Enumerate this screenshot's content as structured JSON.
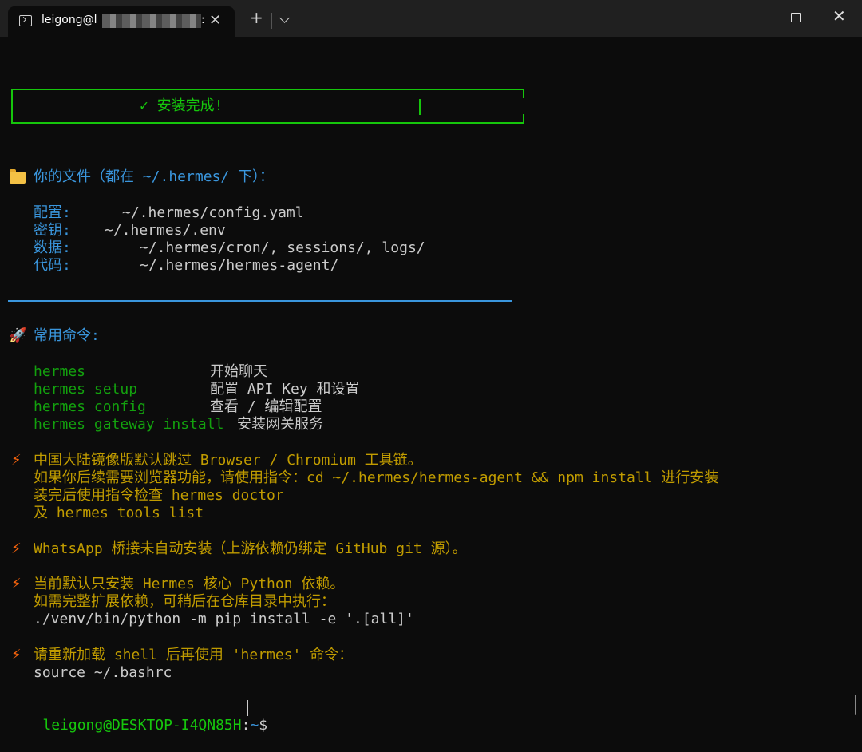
{
  "window": {
    "tab_title": "leigong@l",
    "tab_title_suffix": ":",
    "new_tab": "+",
    "close_tab": "✕",
    "close_window": "✕"
  },
  "terminal": {
    "banner": "✓ 安装完成!",
    "files_header": "你的文件（都在 ~/.hermes/ 下）：",
    "files": [
      {
        "label": "配置:",
        "path": "~/.hermes/config.yaml"
      },
      {
        "label": "密钥:",
        "path": "~/.hermes/.env"
      },
      {
        "label": "数据:",
        "path": "~/.hermes/cron/, sessions/, logs/"
      },
      {
        "label": "代码:",
        "path": "~/.hermes/hermes-agent/"
      }
    ],
    "commands_header": "常用命令:",
    "commands": [
      {
        "cmd": "hermes",
        "desc": "开始聊天"
      },
      {
        "cmd": "hermes setup",
        "desc": "配置 API Key 和设置"
      },
      {
        "cmd": "hermes config",
        "desc": "查看 / 编辑配置"
      },
      {
        "cmd": "hermes gateway install",
        "desc": "安装网关服务"
      }
    ],
    "note1": [
      "中国大陆镜像版默认跳过 Browser / Chromium 工具链。",
      "如果你后续需要浏览器功能，请使用指令：cd ~/.hermes/hermes-agent && npm install 进行安装",
      "装完后使用指令检查 hermes doctor",
      "及 hermes tools list"
    ],
    "note2": "WhatsApp 桥接未自动安装（上游依赖仍绑定 GitHub git 源）。",
    "note3": [
      "当前默认只安装 Hermes 核心 Python 依赖。",
      "如需完整扩展依赖，可稍后在仓库目录中执行：",
      "./venv/bin/python -m pip install -e '.[all]'"
    ],
    "note4": [
      "请重新加载 shell 后再使用 'hermes' 命令：",
      "source ~/.bashrc"
    ],
    "prompt_user": "leigong@DESKTOP-I4QN85H",
    "prompt_sep": ":",
    "prompt_path": "~",
    "prompt_symbol": "$"
  },
  "colors": {
    "background": "#0c0c0c",
    "green": "#13a10e",
    "bright_green": "#16c60c",
    "cyan": "#3a96dd",
    "yellow": "#c19c00",
    "text": "#cccccc"
  },
  "icons": [
    "terminal-icon",
    "folder-icon",
    "rocket-icon",
    "lightning-icon"
  ]
}
